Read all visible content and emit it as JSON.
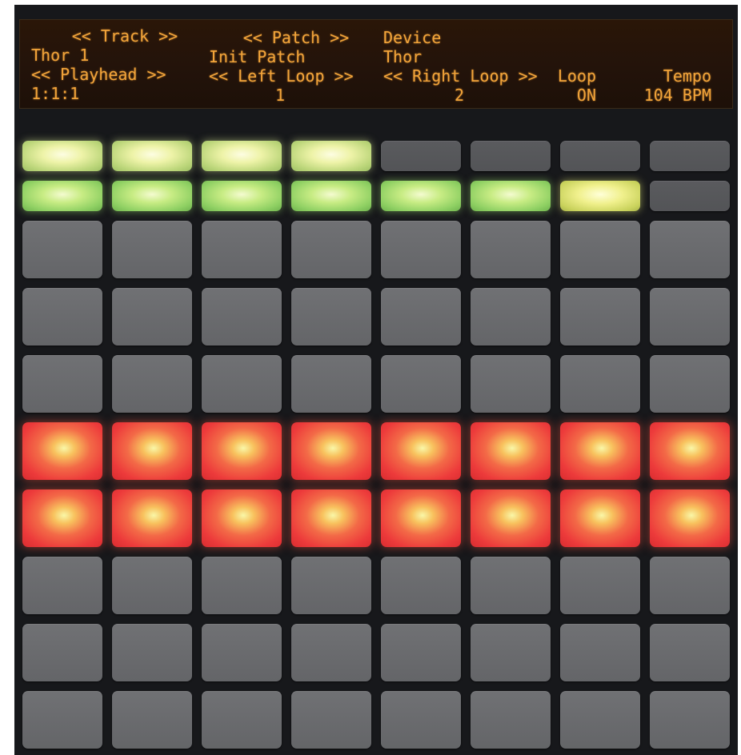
{
  "display": {
    "col1": {
      "row1": "<< Track >>",
      "row2": "Thor 1",
      "row3": "<< Playhead >>",
      "row4": "1:1:1"
    },
    "col2": {
      "row1": "<< Patch >>",
      "row2": "Init Patch",
      "row3": "<< Left Loop >>",
      "row4": "1"
    },
    "col3": {
      "row1": "Device",
      "row2": "Thor",
      "row3": "<< Right Loop >>",
      "row4": "2"
    },
    "loop": {
      "label": "Loop",
      "value": "ON"
    },
    "tempo": {
      "label": "Tempo",
      "value": "104 BPM"
    }
  },
  "colors": {
    "lcd_text": "#f2a43a",
    "pad_off": "#6b6c6f",
    "pad_red": "#ed3b3b",
    "pad_green": "#8fd063",
    "pad_yellow_green": "#eef3a8"
  },
  "pad_grid": {
    "columns": 8,
    "rows": [
      [
        "yg",
        "yg",
        "yg",
        "yg",
        "dim",
        "dim",
        "dim",
        "dim"
      ],
      [
        "g",
        "g",
        "g",
        "g",
        "g",
        "g",
        "y",
        "dim"
      ],
      [
        "off",
        "off",
        "off",
        "off",
        "off",
        "off",
        "off",
        "off"
      ],
      [
        "off",
        "off",
        "off",
        "off",
        "off",
        "off",
        "off",
        "off"
      ],
      [
        "off",
        "off",
        "off",
        "off",
        "off",
        "off",
        "off",
        "off"
      ],
      [
        "red",
        "red",
        "red",
        "red",
        "red",
        "red",
        "red",
        "red"
      ],
      [
        "red",
        "red",
        "red",
        "red",
        "red",
        "red",
        "red",
        "red"
      ],
      [
        "off",
        "off",
        "off",
        "off",
        "off",
        "off",
        "off",
        "off"
      ],
      [
        "off",
        "off",
        "off",
        "off",
        "off",
        "off",
        "off",
        "off"
      ],
      [
        "off",
        "off",
        "off",
        "off",
        "off",
        "off",
        "off",
        "off"
      ]
    ]
  }
}
